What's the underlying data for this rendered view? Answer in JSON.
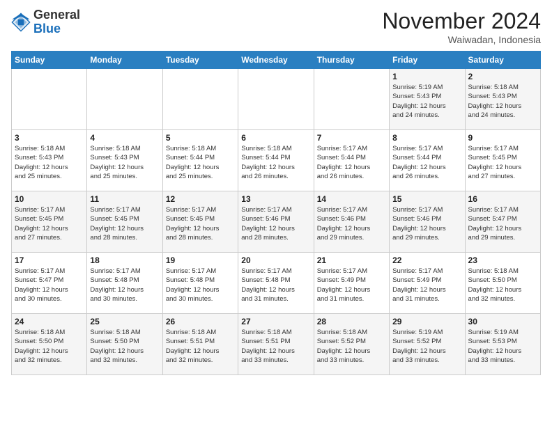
{
  "logo": {
    "general": "General",
    "blue": "Blue"
  },
  "header": {
    "month": "November 2024",
    "location": "Waiwadan, Indonesia"
  },
  "weekdays": [
    "Sunday",
    "Monday",
    "Tuesday",
    "Wednesday",
    "Thursday",
    "Friday",
    "Saturday"
  ],
  "weeks": [
    [
      {
        "day": "",
        "info": ""
      },
      {
        "day": "",
        "info": ""
      },
      {
        "day": "",
        "info": ""
      },
      {
        "day": "",
        "info": ""
      },
      {
        "day": "",
        "info": ""
      },
      {
        "day": "1",
        "info": "Sunrise: 5:19 AM\nSunset: 5:43 PM\nDaylight: 12 hours\nand 24 minutes."
      },
      {
        "day": "2",
        "info": "Sunrise: 5:18 AM\nSunset: 5:43 PM\nDaylight: 12 hours\nand 24 minutes."
      }
    ],
    [
      {
        "day": "3",
        "info": "Sunrise: 5:18 AM\nSunset: 5:43 PM\nDaylight: 12 hours\nand 25 minutes."
      },
      {
        "day": "4",
        "info": "Sunrise: 5:18 AM\nSunset: 5:43 PM\nDaylight: 12 hours\nand 25 minutes."
      },
      {
        "day": "5",
        "info": "Sunrise: 5:18 AM\nSunset: 5:44 PM\nDaylight: 12 hours\nand 25 minutes."
      },
      {
        "day": "6",
        "info": "Sunrise: 5:18 AM\nSunset: 5:44 PM\nDaylight: 12 hours\nand 26 minutes."
      },
      {
        "day": "7",
        "info": "Sunrise: 5:17 AM\nSunset: 5:44 PM\nDaylight: 12 hours\nand 26 minutes."
      },
      {
        "day": "8",
        "info": "Sunrise: 5:17 AM\nSunset: 5:44 PM\nDaylight: 12 hours\nand 26 minutes."
      },
      {
        "day": "9",
        "info": "Sunrise: 5:17 AM\nSunset: 5:45 PM\nDaylight: 12 hours\nand 27 minutes."
      }
    ],
    [
      {
        "day": "10",
        "info": "Sunrise: 5:17 AM\nSunset: 5:45 PM\nDaylight: 12 hours\nand 27 minutes."
      },
      {
        "day": "11",
        "info": "Sunrise: 5:17 AM\nSunset: 5:45 PM\nDaylight: 12 hours\nand 28 minutes."
      },
      {
        "day": "12",
        "info": "Sunrise: 5:17 AM\nSunset: 5:45 PM\nDaylight: 12 hours\nand 28 minutes."
      },
      {
        "day": "13",
        "info": "Sunrise: 5:17 AM\nSunset: 5:46 PM\nDaylight: 12 hours\nand 28 minutes."
      },
      {
        "day": "14",
        "info": "Sunrise: 5:17 AM\nSunset: 5:46 PM\nDaylight: 12 hours\nand 29 minutes."
      },
      {
        "day": "15",
        "info": "Sunrise: 5:17 AM\nSunset: 5:46 PM\nDaylight: 12 hours\nand 29 minutes."
      },
      {
        "day": "16",
        "info": "Sunrise: 5:17 AM\nSunset: 5:47 PM\nDaylight: 12 hours\nand 29 minutes."
      }
    ],
    [
      {
        "day": "17",
        "info": "Sunrise: 5:17 AM\nSunset: 5:47 PM\nDaylight: 12 hours\nand 30 minutes."
      },
      {
        "day": "18",
        "info": "Sunrise: 5:17 AM\nSunset: 5:48 PM\nDaylight: 12 hours\nand 30 minutes."
      },
      {
        "day": "19",
        "info": "Sunrise: 5:17 AM\nSunset: 5:48 PM\nDaylight: 12 hours\nand 30 minutes."
      },
      {
        "day": "20",
        "info": "Sunrise: 5:17 AM\nSunset: 5:48 PM\nDaylight: 12 hours\nand 31 minutes."
      },
      {
        "day": "21",
        "info": "Sunrise: 5:17 AM\nSunset: 5:49 PM\nDaylight: 12 hours\nand 31 minutes."
      },
      {
        "day": "22",
        "info": "Sunrise: 5:17 AM\nSunset: 5:49 PM\nDaylight: 12 hours\nand 31 minutes."
      },
      {
        "day": "23",
        "info": "Sunrise: 5:18 AM\nSunset: 5:50 PM\nDaylight: 12 hours\nand 32 minutes."
      }
    ],
    [
      {
        "day": "24",
        "info": "Sunrise: 5:18 AM\nSunset: 5:50 PM\nDaylight: 12 hours\nand 32 minutes."
      },
      {
        "day": "25",
        "info": "Sunrise: 5:18 AM\nSunset: 5:50 PM\nDaylight: 12 hours\nand 32 minutes."
      },
      {
        "day": "26",
        "info": "Sunrise: 5:18 AM\nSunset: 5:51 PM\nDaylight: 12 hours\nand 32 minutes."
      },
      {
        "day": "27",
        "info": "Sunrise: 5:18 AM\nSunset: 5:51 PM\nDaylight: 12 hours\nand 33 minutes."
      },
      {
        "day": "28",
        "info": "Sunrise: 5:18 AM\nSunset: 5:52 PM\nDaylight: 12 hours\nand 33 minutes."
      },
      {
        "day": "29",
        "info": "Sunrise: 5:19 AM\nSunset: 5:52 PM\nDaylight: 12 hours\nand 33 minutes."
      },
      {
        "day": "30",
        "info": "Sunrise: 5:19 AM\nSunset: 5:53 PM\nDaylight: 12 hours\nand 33 minutes."
      }
    ]
  ]
}
